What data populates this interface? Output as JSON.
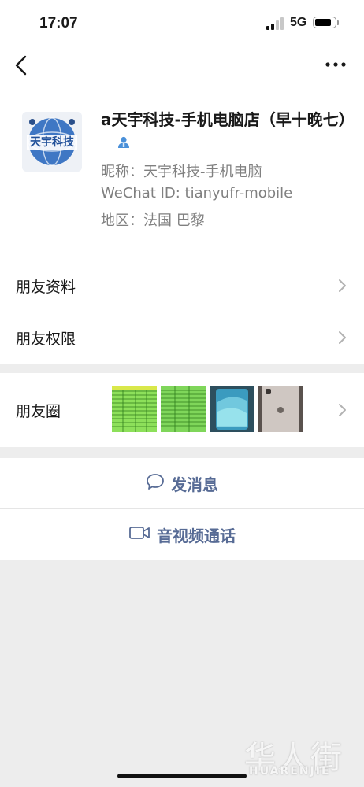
{
  "status_bar": {
    "time": "17:07",
    "network": "5G"
  },
  "profile": {
    "name": "a天宇科技-手机电脑店（早十晚七）",
    "nickname": "昵称：天宇科技-手机电脑",
    "wechat_id": "WeChat ID: tianyufr-mobile",
    "region": "地区：法国 巴黎",
    "avatar_text": "天宇科技"
  },
  "menu": {
    "friend_info": "朋友资料",
    "friend_permissions": "朋友权限",
    "moments": "朋友圈"
  },
  "actions": {
    "send_message": "发消息",
    "video_call": "音视频通话"
  },
  "watermark": {
    "cn": "华人街",
    "en": "HUARENJIE"
  },
  "icons": [
    "back-icon",
    "more-icon",
    "contact-badge-icon",
    "chevron-right-icon",
    "chat-bubble-icon",
    "video-camera-icon"
  ],
  "colors": {
    "link": "#576b95",
    "background": "#ededed",
    "badge": "#4a90d9"
  }
}
